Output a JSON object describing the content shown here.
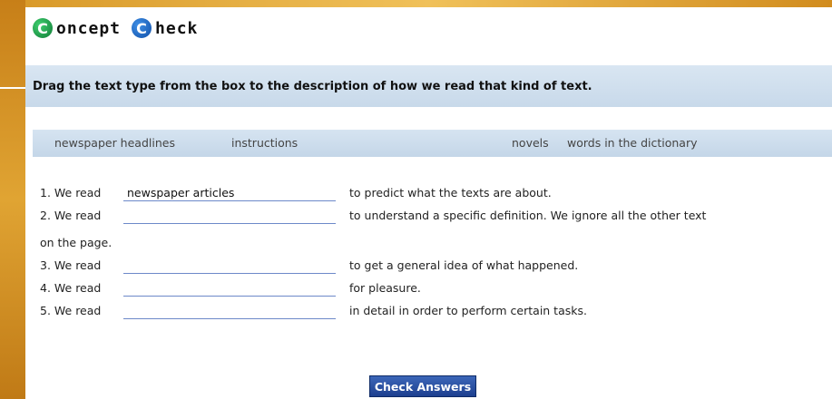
{
  "brand": {
    "letter1": "C",
    "word1": "oncept",
    "letter2": "C",
    "word2": "heck",
    "colors": {
      "circle1": "#1a9a4a",
      "circle2": "#1a5fbf"
    }
  },
  "instruction": "Drag the text type from the box to the description of how we read that kind of text.",
  "word_bank": [
    "newspaper headlines",
    "instructions",
    "novels",
    "words in the dictionary"
  ],
  "questions": [
    {
      "prefix": "1. We read",
      "filled": "newspaper articles",
      "description": "to predict  what the texts are about."
    },
    {
      "prefix": "2. We read",
      "filled": "",
      "description": "to understand  a specific  definition.   We ignore  all  the other text",
      "continuation": "on the page."
    },
    {
      "prefix": "3. We read",
      "filled": "",
      "description": "to get a general idea of what happened."
    },
    {
      "prefix": "4. We read",
      "filled": "",
      "description": "for pleasure."
    },
    {
      "prefix": "5. We read",
      "filled": "",
      "description": "in detail  in order to perform certain tasks."
    }
  ],
  "check_button": "Check Answers",
  "colors": {
    "accent": "#1d3f8f",
    "frame": "#c9861c",
    "bar": "#d3e2f0"
  }
}
